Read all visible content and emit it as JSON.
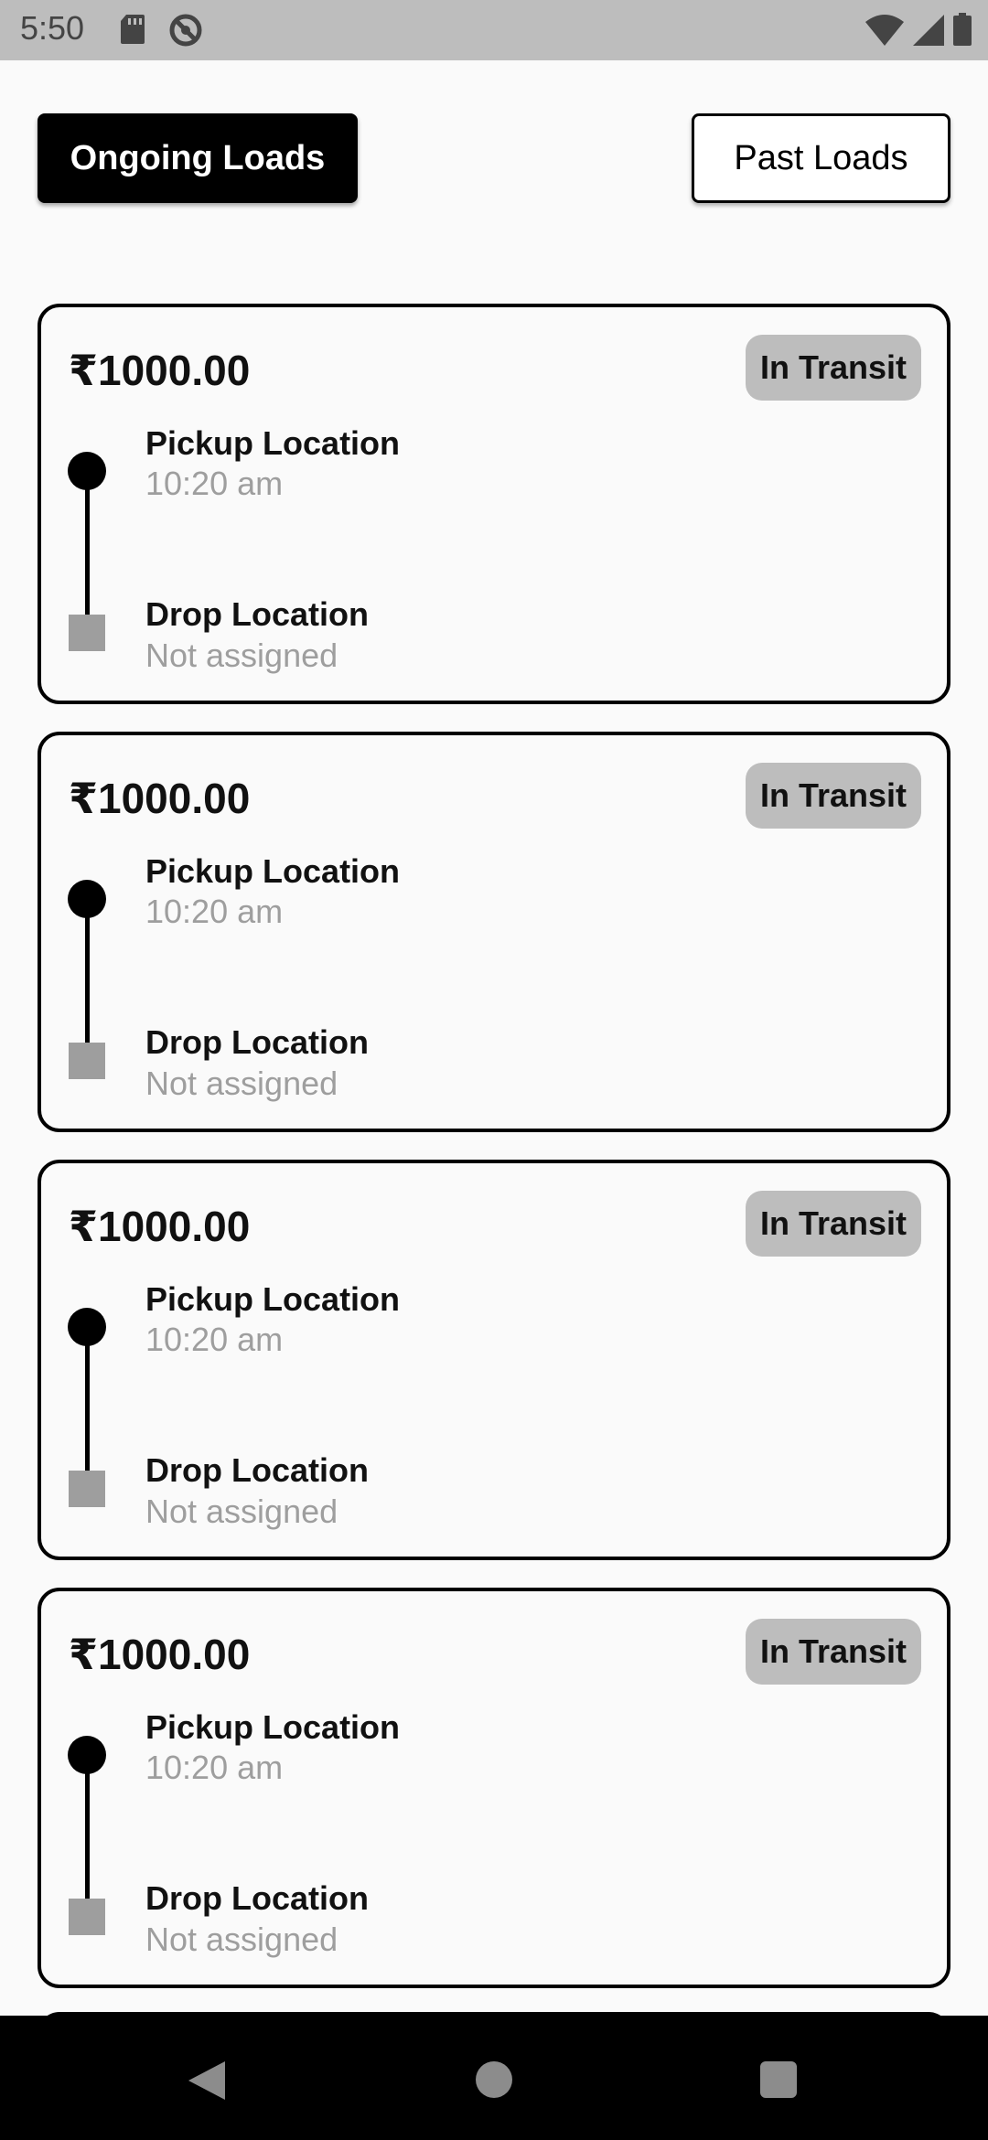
{
  "status_bar": {
    "time": "5:50",
    "icons": [
      "sd-card-icon",
      "do-not-disturb-icon",
      "wifi-icon",
      "signal-icon",
      "battery-icon"
    ]
  },
  "tabs": {
    "ongoing_label": "Ongoing Loads",
    "past_label": "Past Loads"
  },
  "loads": [
    {
      "price": "₹1000.00",
      "status": "In Transit",
      "pickup_label": "Pickup Location",
      "pickup_time": "10:20 am",
      "drop_label": "Drop Location",
      "drop_status": "Not assigned"
    },
    {
      "price": "₹1000.00",
      "status": "In Transit",
      "pickup_label": "Pickup Location",
      "pickup_time": "10:20 am",
      "drop_label": "Drop Location",
      "drop_status": "Not assigned"
    },
    {
      "price": "₹1000.00",
      "status": "In Transit",
      "pickup_label": "Pickup Location",
      "pickup_time": "10:20 am",
      "drop_label": "Drop Location",
      "drop_status": "Not assigned"
    },
    {
      "price": "₹1000.00",
      "status": "In Transit",
      "pickup_label": "Pickup Location",
      "pickup_time": "10:20 am",
      "drop_label": "Drop Location",
      "drop_status": "Not assigned"
    }
  ],
  "colors": {
    "status_bar_bg": "#bdbdbd",
    "badge_bg": "#bdbdbd",
    "muted_text": "#9e9e9e",
    "drop_marker": "#9e9e9e",
    "nav_bg": "#000000"
  }
}
